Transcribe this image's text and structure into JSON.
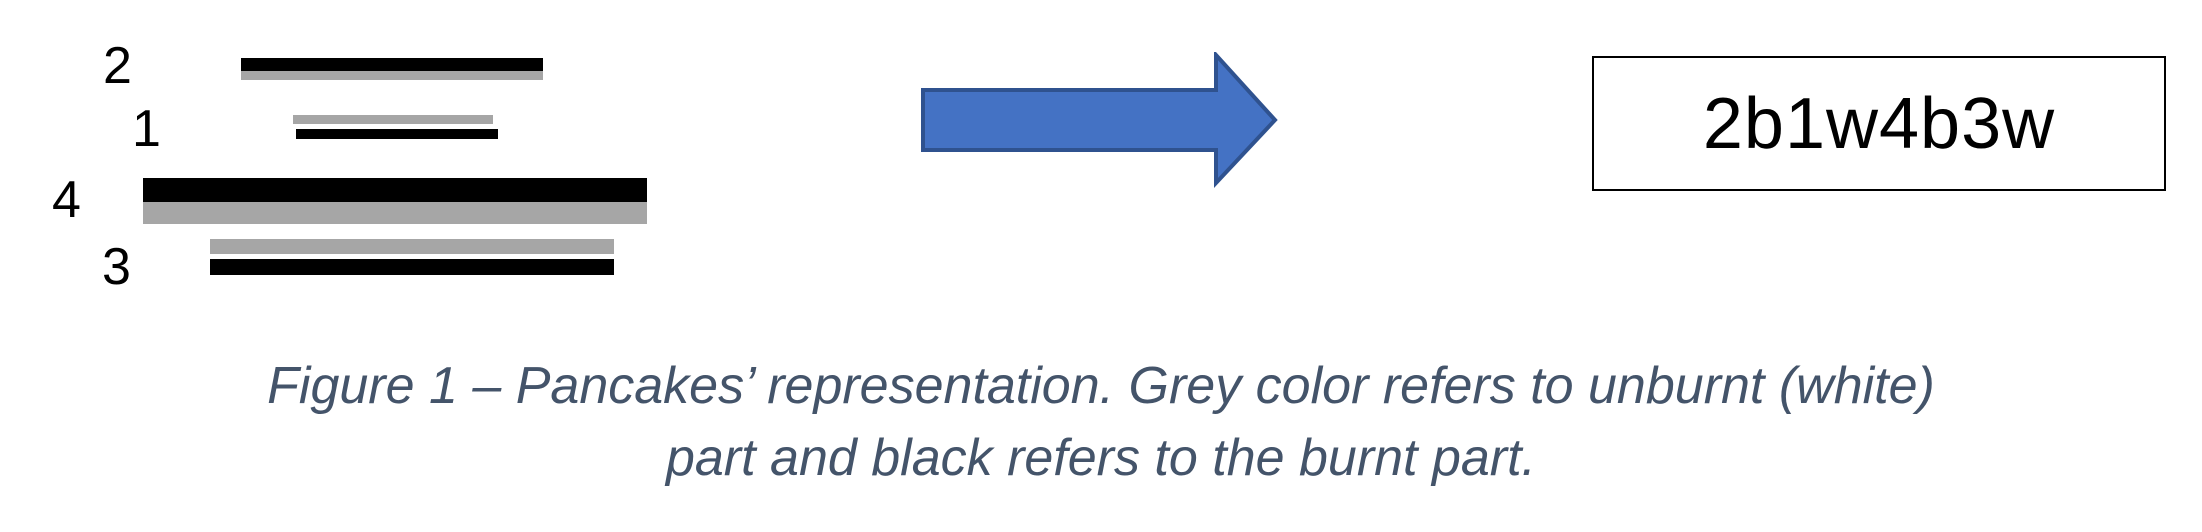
{
  "colors": {
    "burnt": "#000000",
    "unburnt": "#a6a6a6",
    "arrow_fill": "#4472c4",
    "arrow_stroke": "#2f528f",
    "caption": "#44546a"
  },
  "pancakes": [
    {
      "label": "2",
      "top_side": "burnt",
      "bottom_side": "unburnt"
    },
    {
      "label": "1",
      "top_side": "unburnt",
      "bottom_side": "burnt"
    },
    {
      "label": "4",
      "top_side": "burnt",
      "bottom_side": "unburnt"
    },
    {
      "label": "3",
      "top_side": "unburnt",
      "bottom_side": "burnt"
    }
  ],
  "arrow_icon": "right-arrow-icon",
  "encoding": "2b1w4b3w",
  "caption": {
    "line1": "Figure 1 – Pancakes’ representation. Grey color refers to unburnt (white)",
    "line2": "part and black refers to the burnt part."
  }
}
